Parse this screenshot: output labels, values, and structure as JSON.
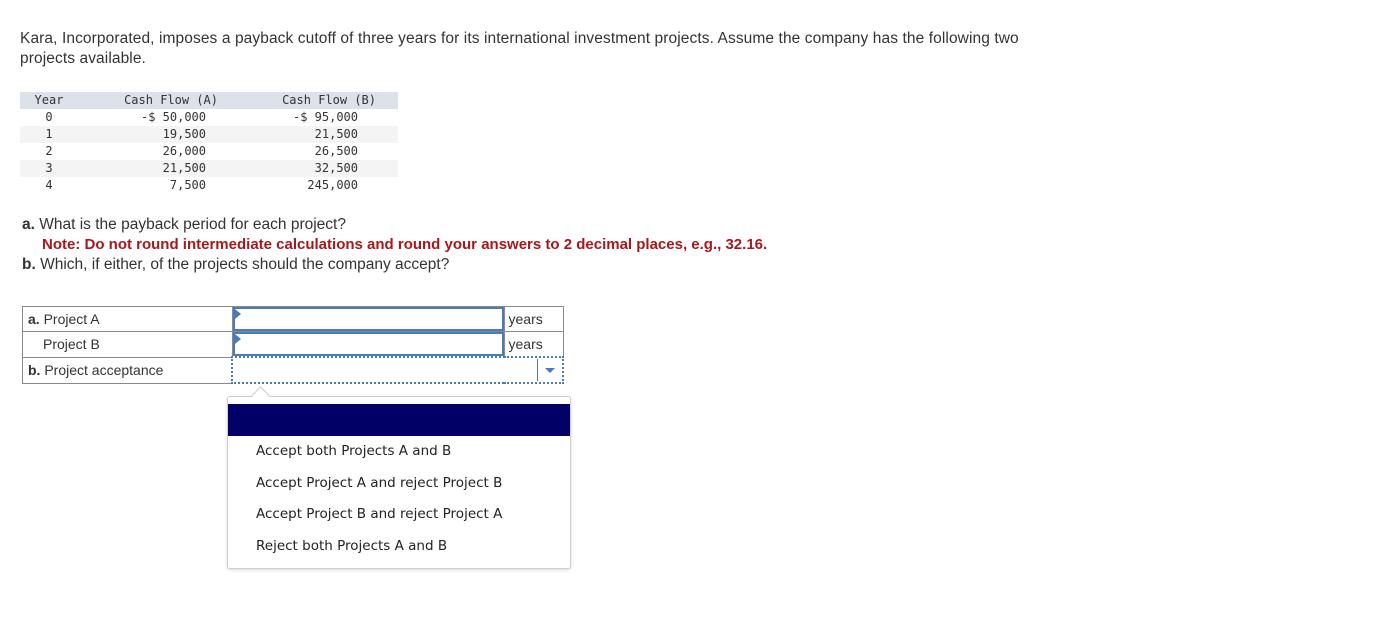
{
  "problem": {
    "intro": "Kara, Incorporated, imposes a payback cutoff of three years for its international investment projects. Assume the company has the following two projects available."
  },
  "cash_flow_table": {
    "headers": [
      "Year",
      "Cash Flow (A)",
      "Cash Flow (B)"
    ],
    "rows": [
      {
        "year": "0",
        "a": "-$ 50,000",
        "b": "-$ 95,000"
      },
      {
        "year": "1",
        "a": "19,500",
        "b": "21,500"
      },
      {
        "year": "2",
        "a": "26,000",
        "b": "26,500"
      },
      {
        "year": "3",
        "a": "21,500",
        "b": "32,500"
      },
      {
        "year": "4",
        "a": "7,500",
        "b": "245,000"
      }
    ]
  },
  "questions": {
    "a_prefix": "a.",
    "a_text": " What is the payback period for each project?",
    "note": "Note: Do not round intermediate calculations and round your answers to 2 decimal places, e.g., 32.16.",
    "b_prefix": "b.",
    "b_text": " Which, if either, of the projects should the company accept?"
  },
  "answers": {
    "project_a": {
      "prefix": "a.",
      "label": " Project A",
      "value": "",
      "unit": "years"
    },
    "project_b": {
      "label": "Project B",
      "value": "",
      "unit": "years"
    },
    "acceptance": {
      "prefix": "b.",
      "label": " Project acceptance",
      "selected": ""
    }
  },
  "dropdown": {
    "options": [
      "Accept both Projects A and B",
      "Accept Project A and reject Project B",
      "Accept Project B and reject Project A",
      "Reject both Projects A and B"
    ]
  },
  "colors": {
    "note_red": "#a8171b",
    "input_blue": "#4a7bb8",
    "highlight_navy": "#000066",
    "table_header_bg": "#dce1ea"
  }
}
